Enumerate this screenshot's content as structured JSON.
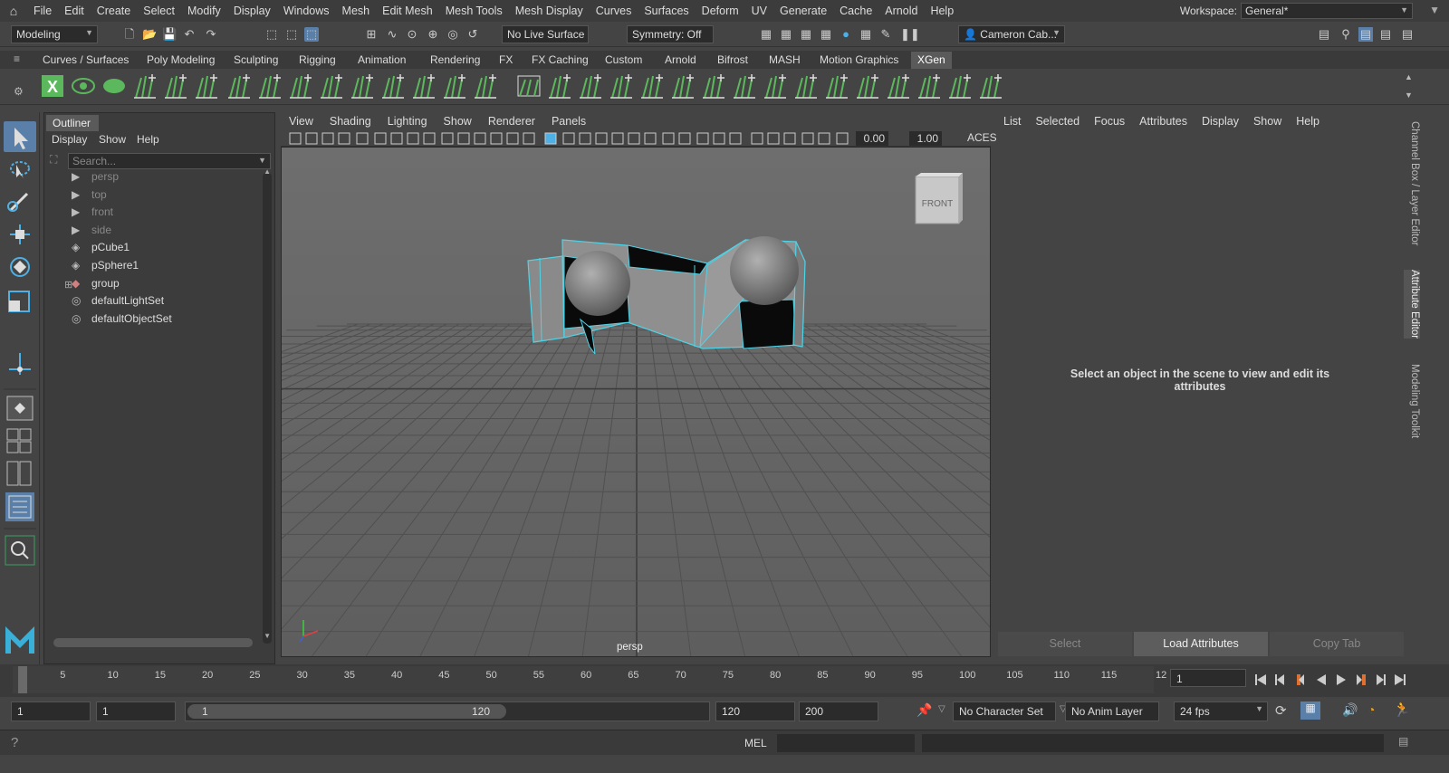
{
  "menubar": {
    "items": [
      "File",
      "Edit",
      "Create",
      "Select",
      "Modify",
      "Display",
      "Windows",
      "Mesh",
      "Edit Mesh",
      "Mesh Tools",
      "Mesh Display",
      "Curves",
      "Surfaces",
      "Deform",
      "UV",
      "Generate",
      "Cache",
      "Arnold",
      "Help"
    ],
    "workspace_label": "Workspace:",
    "workspace_value": "General*"
  },
  "statusline": {
    "menuset": "Modeling",
    "live_surface": "No Live Surface",
    "symmetry": "Symmetry: Off",
    "account": "Cameron Cab..."
  },
  "shelf": {
    "tabs": [
      "Curves / Surfaces",
      "Poly Modeling",
      "Sculpting",
      "Rigging",
      "Animation",
      "Rendering",
      "FX",
      "FX Caching",
      "Custom",
      "Arnold",
      "Bifrost",
      "MASH",
      "Motion Graphics",
      "XGen"
    ],
    "active_tab": "XGen",
    "accent_color": "#5cb85c"
  },
  "outliner": {
    "tab": "Outliner",
    "menus": [
      "Display",
      "Show",
      "Help"
    ],
    "search_placeholder": "Search...",
    "items": [
      {
        "label": "persp",
        "icon": "camera-icon",
        "dim": true
      },
      {
        "label": "top",
        "icon": "camera-icon",
        "dim": true
      },
      {
        "label": "front",
        "icon": "camera-icon",
        "dim": true
      },
      {
        "label": "side",
        "icon": "camera-icon",
        "dim": true
      },
      {
        "label": "pCube1",
        "icon": "mesh-icon",
        "dim": false
      },
      {
        "label": "pSphere1",
        "icon": "mesh-icon",
        "dim": false
      },
      {
        "label": "group",
        "icon": "group-icon",
        "dim": false
      },
      {
        "label": "defaultLightSet",
        "icon": "set-icon",
        "dim": false
      },
      {
        "label": "defaultObjectSet",
        "icon": "set-icon",
        "dim": false
      }
    ]
  },
  "viewport": {
    "menus": [
      "View",
      "Shading",
      "Lighting",
      "Show",
      "Renderer",
      "Panels"
    ],
    "exposure": "0.00",
    "gamma": "1.00",
    "color_space": "ACES",
    "camera_label": "persp",
    "viewcube_label": "FRONT",
    "selection_color": "#4fd3e6"
  },
  "attribute_editor": {
    "menus": [
      "List",
      "Selected",
      "Focus",
      "Attributes",
      "Display",
      "Show",
      "Help"
    ],
    "message": "Select an object in the scene to view and edit its attributes",
    "buttons": [
      "Select",
      "Load Attributes",
      "Copy Tab"
    ]
  },
  "side_tabs": [
    "Channel Box / Layer Editor",
    "Attribute Editor",
    "Modeling Toolkit"
  ],
  "timeline": {
    "ticks": [
      "1",
      "5",
      "10",
      "15",
      "20",
      "25",
      "30",
      "35",
      "40",
      "45",
      "50",
      "55",
      "60",
      "65",
      "70",
      "75",
      "80",
      "85",
      "90",
      "95",
      "100",
      "105",
      "110",
      "115",
      "12"
    ],
    "current_frame": "1"
  },
  "range": {
    "start": "1",
    "playback_start": "1",
    "slider_start": "1",
    "slider_end": "120",
    "playback_end": "120",
    "end": "200",
    "character_set": "No Character Set",
    "anim_layer": "No Anim Layer",
    "fps": "24 fps"
  },
  "command_line": {
    "language": "MEL"
  }
}
